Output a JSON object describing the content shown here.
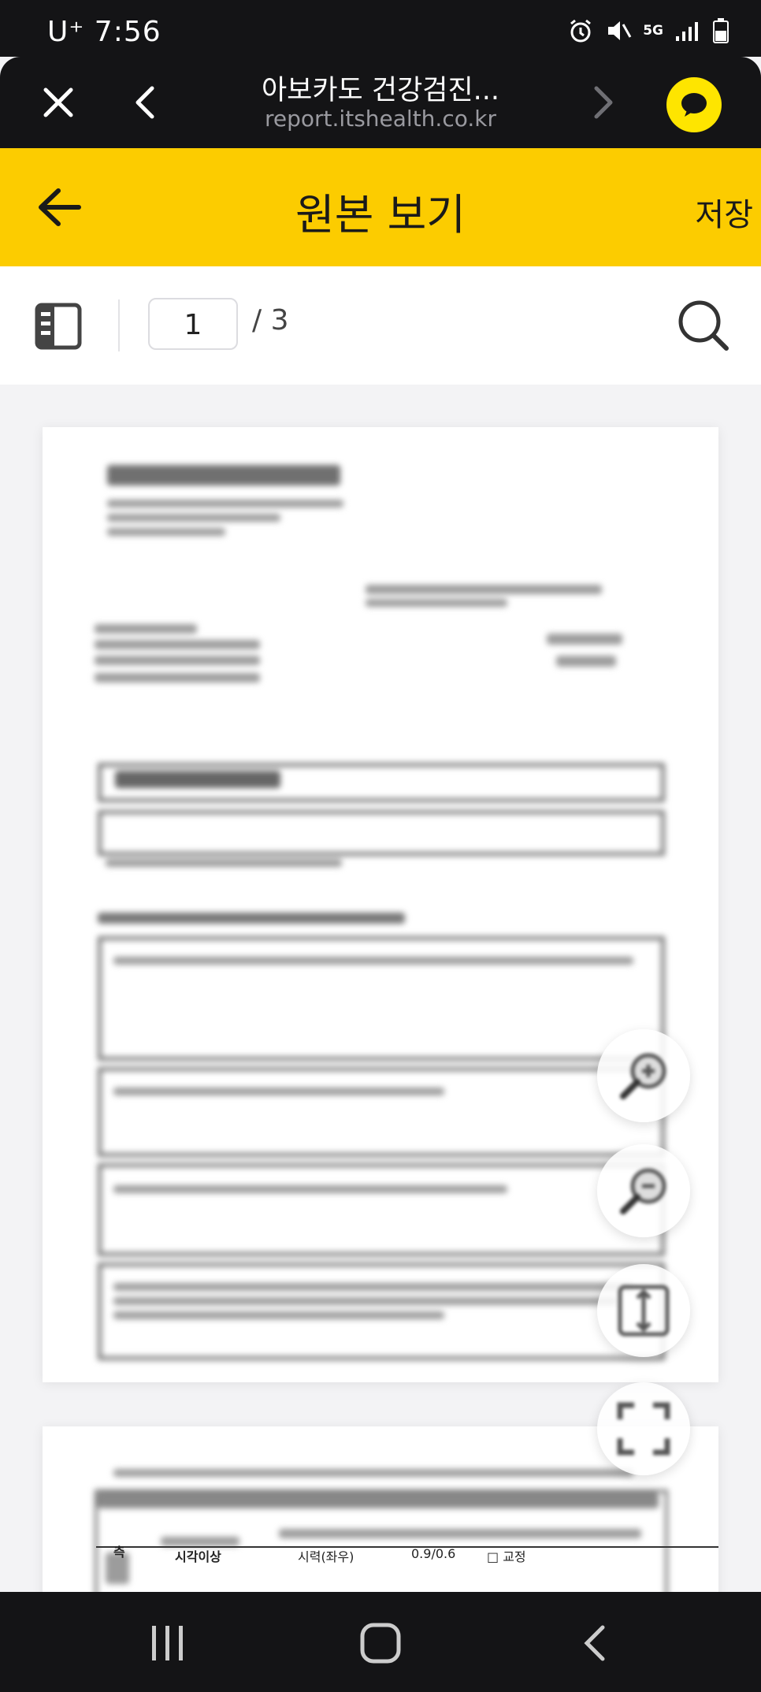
{
  "status_bar": {
    "carrier": "U⁺ 7:56",
    "network": "5G"
  },
  "browser": {
    "title": "아보카도 건강검진...",
    "url": "report.itshealth.co.kr"
  },
  "header": {
    "title": "원본 보기",
    "save_label": "저장"
  },
  "toolbar": {
    "current_page": "1",
    "total_pages": "/ 3"
  },
  "document": {
    "page2_row": {
      "label": "시각이상",
      "col2": "시력(좌우)",
      "col3": "0.9/0.6",
      "col4": "□ 교정",
      "side": "측"
    }
  },
  "icons": {
    "close": "close-icon",
    "back": "chevron-left-icon",
    "forward": "chevron-right-icon",
    "chat": "chat-bubble-icon",
    "arrow_back": "arrow-left-icon",
    "thumbnails": "thumbnail-panel-icon",
    "search": "search-icon",
    "zoom_in": "zoom-in-icon",
    "zoom_out": "zoom-out-icon",
    "fit_page": "fit-page-icon",
    "fullscreen": "fullscreen-icon"
  },
  "colors": {
    "accent": "#fccc00",
    "dark": "#141416",
    "kakao": "#fee500"
  }
}
